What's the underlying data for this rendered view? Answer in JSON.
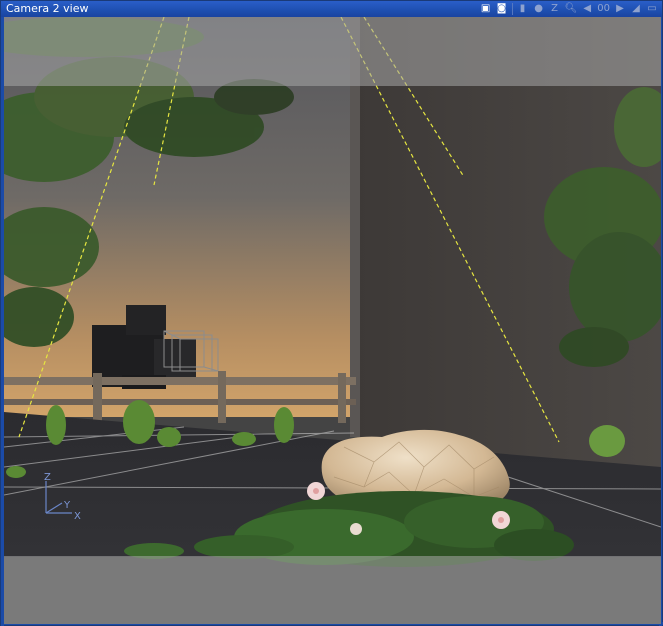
{
  "window": {
    "title": "Camera 2 view"
  },
  "toolbar": {
    "buttons": [
      {
        "name": "render-preview-icon",
        "glyph": "▣"
      },
      {
        "name": "camera-settings-icon",
        "glyph": "◙"
      },
      {
        "name": "frame-icon",
        "glyph": "▮"
      },
      {
        "name": "dot-icon",
        "glyph": "●"
      },
      {
        "name": "zoom-z-label",
        "glyph": "Z"
      },
      {
        "name": "zoom-icon",
        "glyph": "🔍︎"
      },
      {
        "name": "frame-prev-icon",
        "glyph": "◀"
      },
      {
        "name": "frame-number",
        "glyph": "00"
      },
      {
        "name": "frame-next-icon",
        "glyph": "▶"
      },
      {
        "name": "angle-icon",
        "glyph": "◢"
      },
      {
        "name": "maximize-icon",
        "glyph": "▭"
      }
    ]
  },
  "colors": {
    "titlebar": "#1e4fb0",
    "sky_top": "#5f6066",
    "sky_horizon": "#c79a62",
    "wall": "#4b4744",
    "ground": "#2f2f33",
    "rock": "#d7bf9d",
    "foliage": "#3f6a2d",
    "camera_guides": "#e8e84a",
    "mask_overlay": "#9a9a9a"
  },
  "viewport": {
    "axis_labels": {
      "z": "Z",
      "y": "Y",
      "x": "X"
    }
  }
}
